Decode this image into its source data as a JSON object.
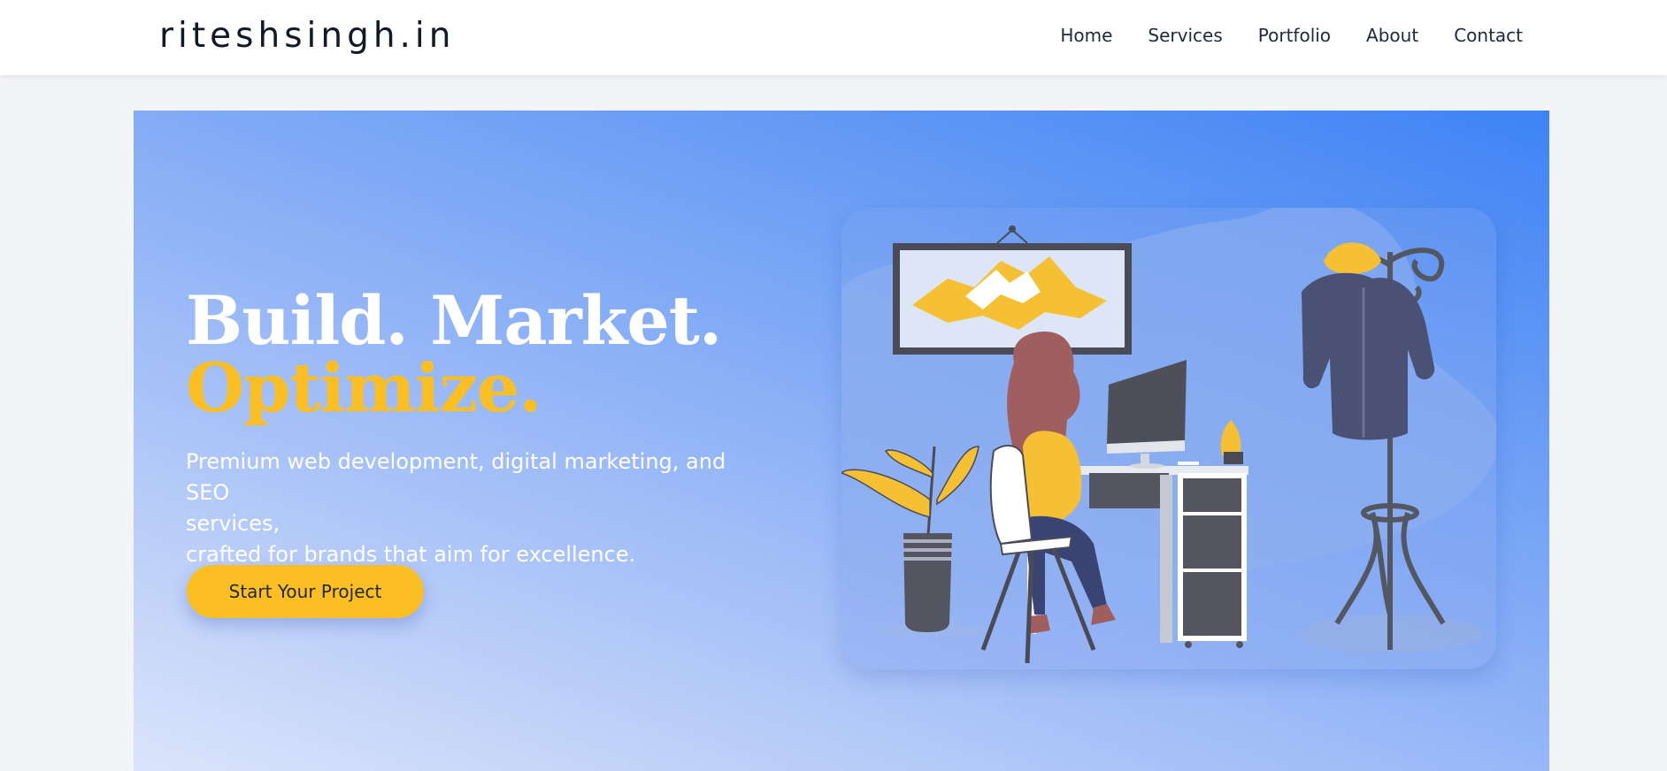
{
  "header": {
    "logo": "riteshsingh.in",
    "nav": [
      "Home",
      "Services",
      "Portfolio",
      "About",
      "Contact"
    ]
  },
  "hero": {
    "headline_line1": "Build. Market.",
    "headline_line2": "Optimize.",
    "subtitle_lines": [
      "Premium web development, digital marketing, and SEO",
      "services,",
      "crafted for brands that aim for excellence."
    ],
    "cta_label": "Start Your Project"
  },
  "colors": {
    "accent": "#fbbf24",
    "hero_gradient_dark": "#3e83f5",
    "hero_gradient_light": "#dbe4fb",
    "text_dark": "#1f2937"
  },
  "icons": [
    "woman-at-desk-illustration",
    "mountain-painting",
    "computer-monitor",
    "potted-plant",
    "coat-rack",
    "winter-jacket"
  ]
}
